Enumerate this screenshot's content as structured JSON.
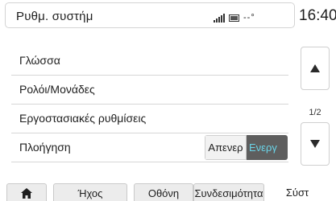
{
  "header": {
    "title": "Ρυθμ. συστήμ",
    "temperature": "--°",
    "clock": "16:40"
  },
  "settings": {
    "items": [
      {
        "label": "Γλώσσα"
      },
      {
        "label": "Ρολόι/Μονάδες"
      },
      {
        "label": "Εργοστασιακές ρυθμίσεις"
      },
      {
        "label": "Πλοήγηση"
      }
    ],
    "navigation_toggle": {
      "off_label": "Απενερ",
      "on_label": "Ενεργ",
      "selected": "on"
    }
  },
  "scroll": {
    "page_indicator": "1/2"
  },
  "tabs": [
    {
      "label": ""
    },
    {
      "label": "Ήχος"
    },
    {
      "label": "Οθόνη"
    },
    {
      "label": "Συνδεσιμότητα"
    },
    {
      "label": "Σύστ"
    }
  ],
  "colors": {
    "toggle_on_text": "#6ad4e8",
    "toggle_on_bg": "#5e5e5e",
    "tab_bg": "#ececec"
  }
}
